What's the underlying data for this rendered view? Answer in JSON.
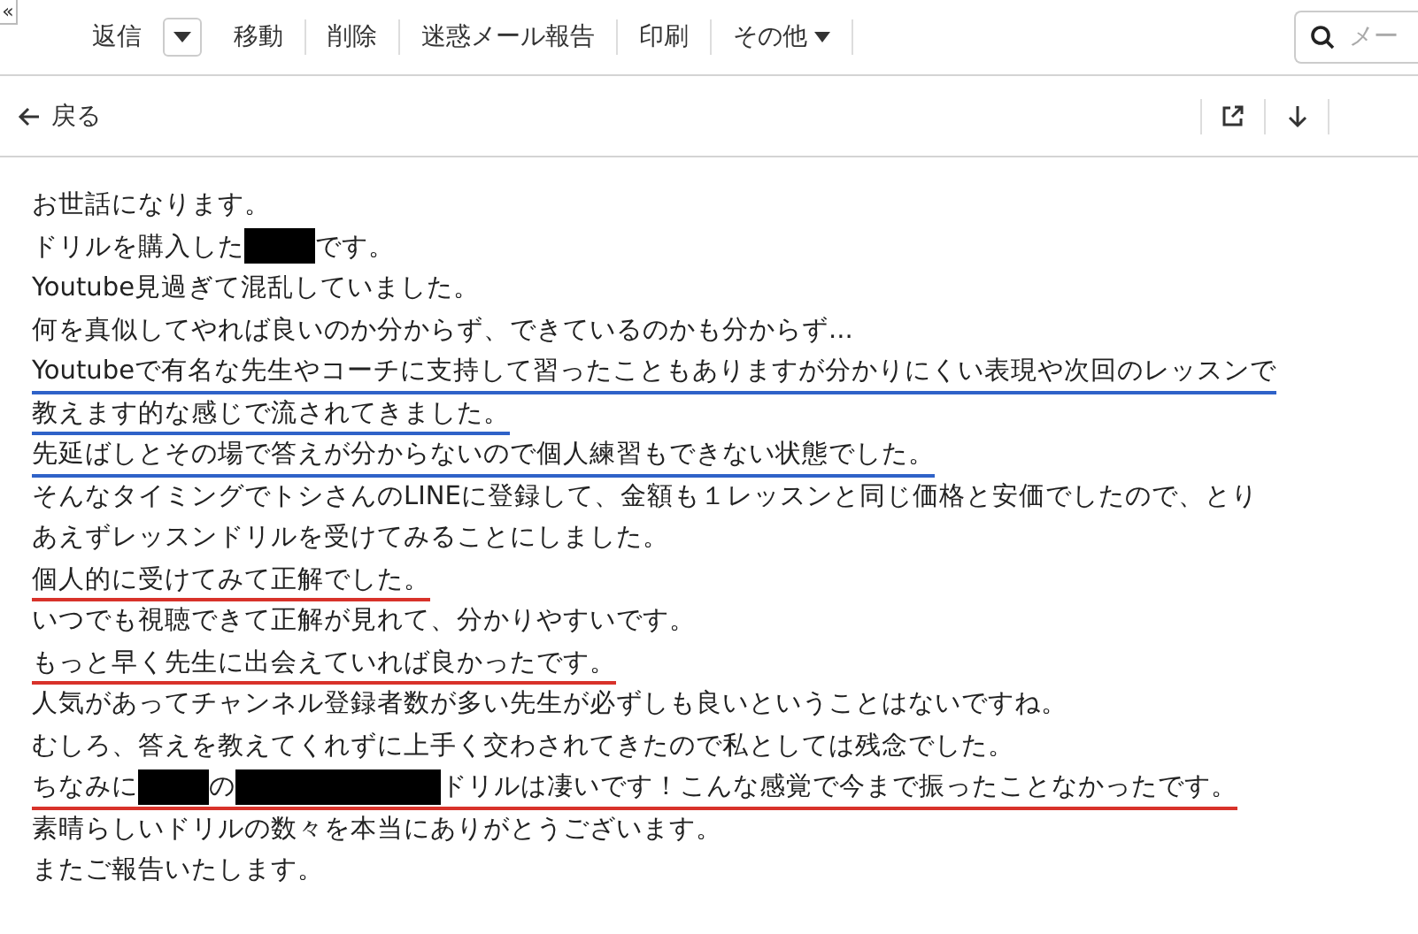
{
  "toolbar": {
    "collapse_glyph": "«",
    "actions": [
      {
        "label": "返信",
        "kind": "plain"
      },
      {
        "kind": "caret"
      },
      {
        "label": "移動",
        "kind": "plain"
      },
      {
        "label": "削除",
        "kind": "plain"
      },
      {
        "label": "迷惑メール報告",
        "kind": "plain"
      },
      {
        "label": "印刷",
        "kind": "plain"
      },
      {
        "label": "その他",
        "kind": "menu"
      }
    ],
    "search": {
      "placeholder": "メー"
    }
  },
  "nav": {
    "back_label": "戻る"
  },
  "message": {
    "lines": [
      {
        "segments": [
          {
            "kind": "text",
            "text": "お世話になります。"
          }
        ]
      },
      {
        "segments": [
          {
            "kind": "text",
            "text": "ドリルを購入した"
          },
          {
            "kind": "redacted_short"
          },
          {
            "kind": "text",
            "text": "です。"
          }
        ]
      },
      {
        "segments": [
          {
            "kind": "text",
            "text": "Youtube見過ぎて混乱していました。"
          }
        ]
      },
      {
        "segments": [
          {
            "kind": "text",
            "text": "何を真似してやれば良いのか分からず、できているのかも分からず..."
          }
        ]
      },
      {
        "color": "#2f62c8",
        "segments": [
          {
            "kind": "text",
            "text": "Youtubeで有名な先生やコーチに支持して習ったこともありますが分かりにくい表現や次回のレッスンで"
          }
        ]
      },
      {
        "color": "#2f62c8",
        "segments": [
          {
            "kind": "text",
            "text": "教えます的な感じで流されてきました。"
          }
        ]
      },
      {
        "color": "#2f62c8",
        "segments": [
          {
            "kind": "text",
            "text": "先延ばしとその場で答えが分からないので個人練習もできない状態でした。"
          }
        ]
      },
      {
        "segments": [
          {
            "kind": "text",
            "text": "そんなタイミングでトシさんのLINEに登録して、金額も１レッスンと同じ価格と安価でしたので、とり"
          }
        ]
      },
      {
        "segments": [
          {
            "kind": "text",
            "text": "あえずレッスンドリルを受けてみることにしました。"
          }
        ]
      },
      {
        "color": "#d8322a",
        "segments": [
          {
            "kind": "text",
            "text": "個人的に受けてみて正解でした。"
          }
        ]
      },
      {
        "segments": [
          {
            "kind": "text",
            "text": "いつでも視聴できて正解が見れて、分かりやすいです。"
          }
        ]
      },
      {
        "color": "#d8322a",
        "segments": [
          {
            "kind": "text",
            "text": "もっと早く先生に出会えていれば良かったです。"
          }
        ]
      },
      {
        "segments": [
          {
            "kind": "text",
            "text": "人気があってチャンネル登録者数が多い先生が必ずしも良いということはないですね。"
          }
        ]
      },
      {
        "segments": [
          {
            "kind": "text",
            "text": "むしろ、答えを教えてくれずに上手く交わされてきたので私としては残念でした。"
          }
        ]
      },
      {
        "color": "#d8322a",
        "segments": [
          {
            "kind": "text",
            "text": "ちなみに"
          },
          {
            "kind": "redacted_short"
          },
          {
            "kind": "text",
            "text": "の"
          },
          {
            "kind": "redacted_long"
          },
          {
            "kind": "text",
            "text": "ドリルは凄いです！こんな感覚で今まで振ったことなかったです。"
          }
        ]
      },
      {
        "segments": [
          {
            "kind": "text",
            "text": "素晴らしいドリルの数々を本当にありがとうございます。"
          }
        ]
      },
      {
        "segments": [
          {
            "kind": "text",
            "text": "またご報告いたします。"
          }
        ]
      }
    ]
  }
}
